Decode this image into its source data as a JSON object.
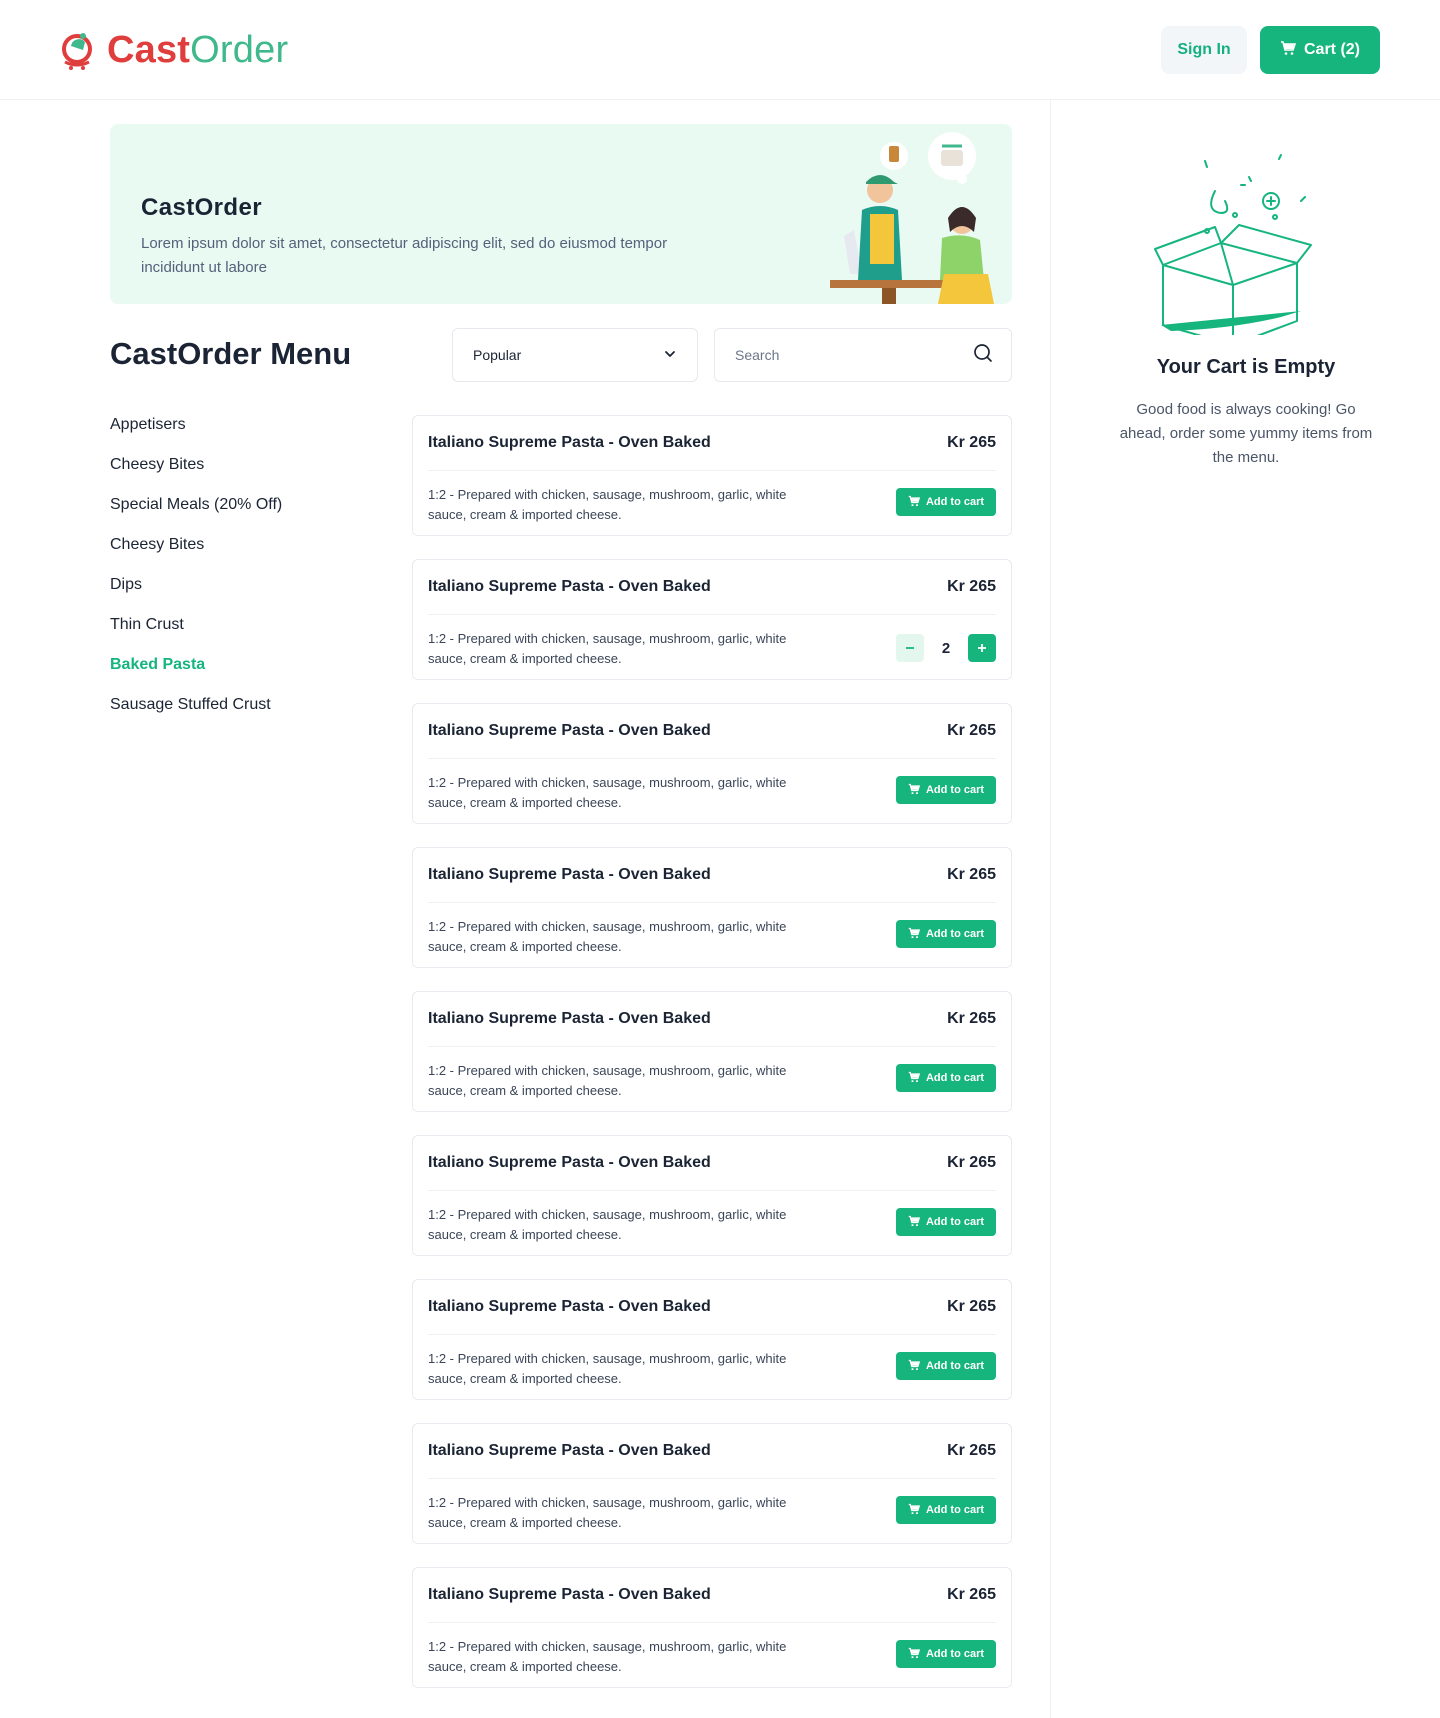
{
  "header": {
    "brand_part1": "Cast",
    "brand_part2": "Order",
    "signin_label": "Sign In",
    "cart_label": "Cart (2)"
  },
  "banner": {
    "title": "CastOrder",
    "text": "Lorem ipsum dolor sit amet, consectetur adipiscing elit, sed do eiusmod tempor incididunt ut labore"
  },
  "menu": {
    "title": "CastOrder Menu",
    "sort_value": "Popular",
    "search_placeholder": "Search"
  },
  "categories": [
    {
      "label": "Appetisers",
      "active": false
    },
    {
      "label": "Cheesy Bites",
      "active": false
    },
    {
      "label": "Special Meals (20% Off)",
      "active": false
    },
    {
      "label": "Cheesy Bites",
      "active": false
    },
    {
      "label": "Dips",
      "active": false
    },
    {
      "label": "Thin Crust",
      "active": false
    },
    {
      "label": "Baked Pasta",
      "active": true
    },
    {
      "label": "Sausage Stuffed Crust",
      "active": false
    }
  ],
  "items": [
    {
      "name": "Italiano Supreme Pasta - Oven Baked",
      "price": "Kr 265",
      "desc": "1:2 - Prepared with chicken, sausage, mushroom, garlic, white sauce, cream & imported cheese.",
      "qty": null
    },
    {
      "name": "Italiano Supreme Pasta - Oven Baked",
      "price": "Kr 265",
      "desc": "1:2 - Prepared with chicken, sausage, mushroom, garlic, white sauce, cream & imported cheese.",
      "qty": "2"
    },
    {
      "name": "Italiano Supreme Pasta - Oven Baked",
      "price": "Kr 265",
      "desc": "1:2 - Prepared with chicken, sausage, mushroom, garlic, white sauce, cream & imported cheese.",
      "qty": null
    },
    {
      "name": "Italiano Supreme Pasta - Oven Baked",
      "price": "Kr 265",
      "desc": "1:2 - Prepared with chicken, sausage, mushroom, garlic, white sauce, cream & imported cheese.",
      "qty": null
    },
    {
      "name": "Italiano Supreme Pasta - Oven Baked",
      "price": "Kr 265",
      "desc": "1:2 - Prepared with chicken, sausage, mushroom, garlic, white sauce, cream & imported cheese.",
      "qty": null
    },
    {
      "name": "Italiano Supreme Pasta - Oven Baked",
      "price": "Kr 265",
      "desc": "1:2 - Prepared with chicken, sausage, mushroom, garlic, white sauce, cream & imported cheese.",
      "qty": null
    },
    {
      "name": "Italiano Supreme Pasta - Oven Baked",
      "price": "Kr 265",
      "desc": "1:2 - Prepared with chicken, sausage, mushroom, garlic, white sauce, cream & imported cheese.",
      "qty": null
    },
    {
      "name": "Italiano Supreme Pasta - Oven Baked",
      "price": "Kr 265",
      "desc": "1:2 - Prepared with chicken, sausage, mushroom, garlic, white sauce, cream & imported cheese.",
      "qty": null
    },
    {
      "name": "Italiano Supreme Pasta - Oven Baked",
      "price": "Kr 265",
      "desc": "1:2 - Prepared with chicken, sausage, mushroom, garlic, white sauce, cream & imported cheese.",
      "qty": null
    }
  ],
  "add_to_cart_label": "Add to cart",
  "cart_panel": {
    "title": "Your Cart is Empty",
    "text": "Good food is always cooking! Go ahead, order some yummy items from the menu."
  },
  "icons": {
    "logo": "castorder-logo-icon",
    "cart": "cart-icon",
    "chevron": "chevron-down-icon",
    "search": "search-icon",
    "minus": "minus-icon",
    "plus": "plus-icon",
    "empty_cart": "empty-box-illustration"
  },
  "colors": {
    "brand_red": "#e03d3d",
    "brand_green": "#16b57e",
    "banner_bg": "#e9faf3"
  }
}
